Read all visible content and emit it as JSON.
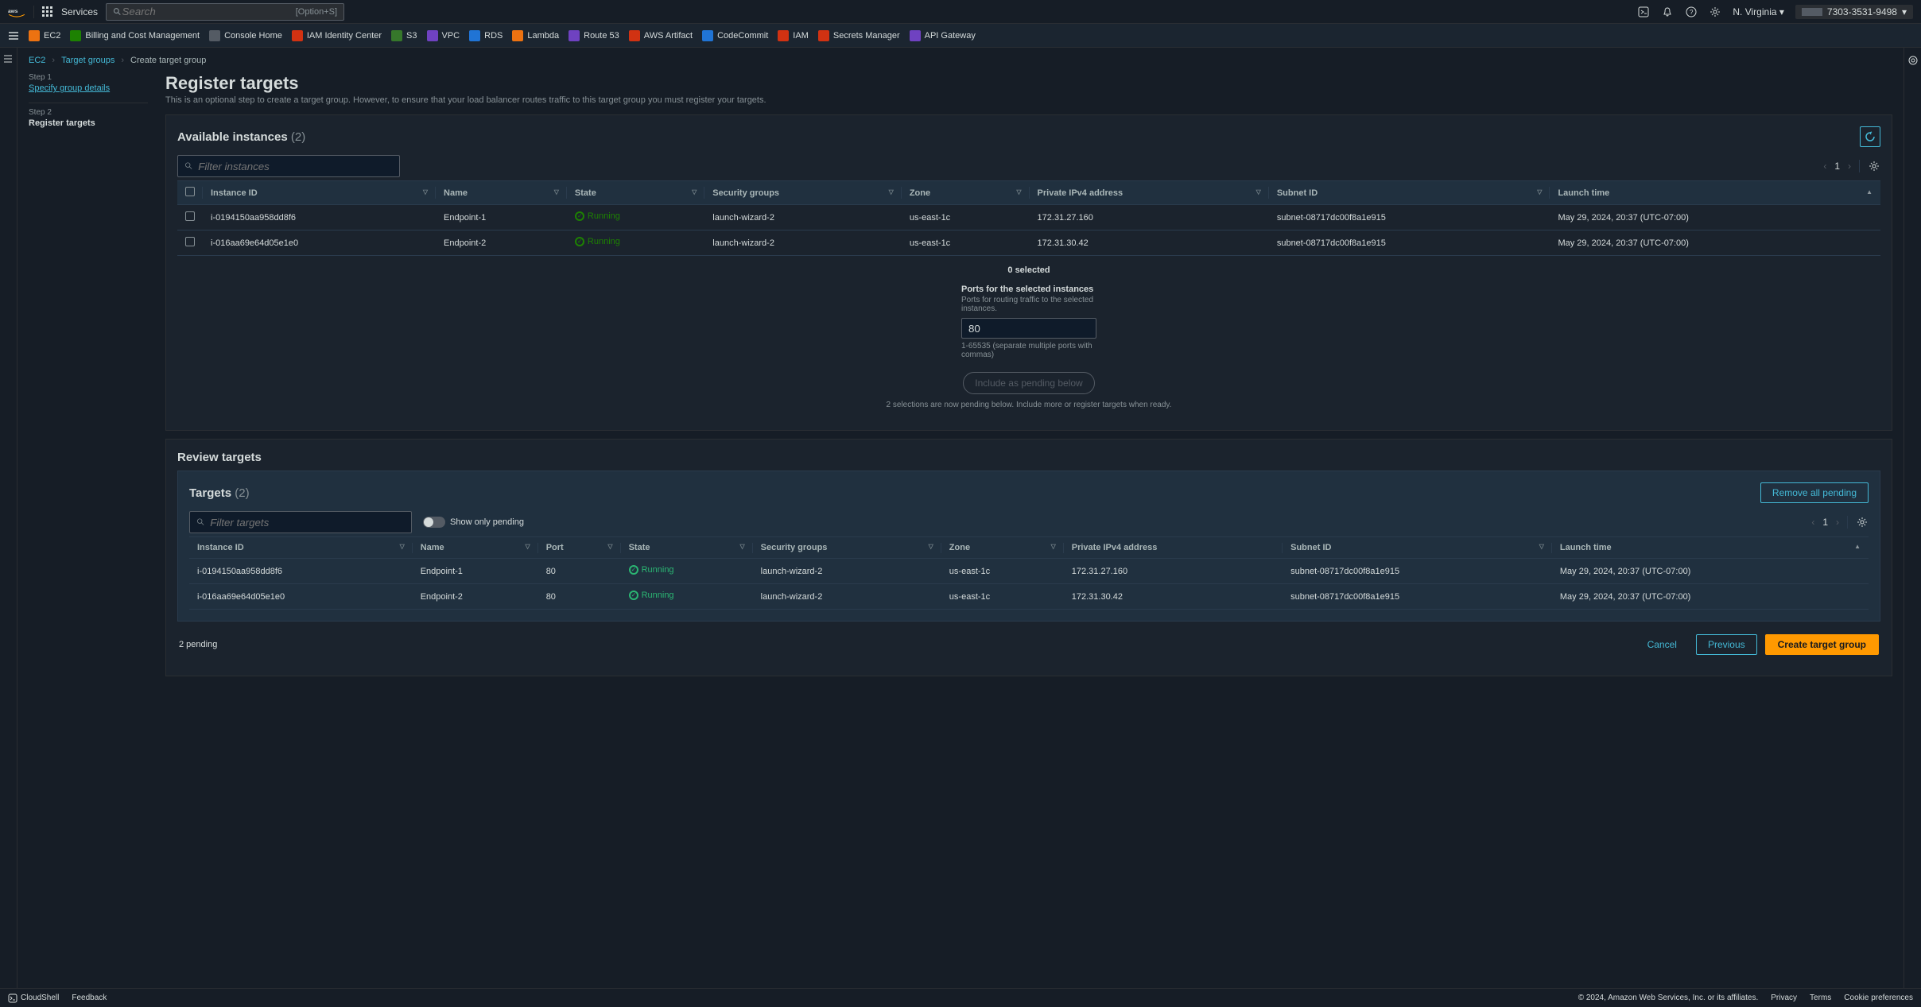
{
  "header": {
    "services_label": "Services",
    "search_placeholder": "Search",
    "search_hint": "[Option+S]",
    "region": "N. Virginia",
    "account_id": "7303-3531-9498"
  },
  "favorites": [
    {
      "label": "EC2",
      "color": "orange"
    },
    {
      "label": "Billing and Cost Management",
      "color": "green"
    },
    {
      "label": "Console Home",
      "color": "gray"
    },
    {
      "label": "IAM Identity Center",
      "color": "red"
    },
    {
      "label": "S3",
      "color": "dgreen"
    },
    {
      "label": "VPC",
      "color": "violet"
    },
    {
      "label": "RDS",
      "color": "blue"
    },
    {
      "label": "Lambda",
      "color": "orange"
    },
    {
      "label": "Route 53",
      "color": "violet"
    },
    {
      "label": "AWS Artifact",
      "color": "red"
    },
    {
      "label": "CodeCommit",
      "color": "blue"
    },
    {
      "label": "IAM",
      "color": "red"
    },
    {
      "label": "Secrets Manager",
      "color": "red"
    },
    {
      "label": "API Gateway",
      "color": "violet"
    }
  ],
  "breadcrumb": {
    "root": "EC2",
    "parent": "Target groups",
    "current": "Create target group"
  },
  "steps": {
    "step1_num": "Step 1",
    "step1_name": "Specify group details",
    "step2_num": "Step 2",
    "step2_name": "Register targets"
  },
  "page": {
    "title": "Register targets",
    "desc": "This is an optional step to create a target group. However, to ensure that your load balancer routes traffic to this target group you must register your targets."
  },
  "available": {
    "title": "Available instances",
    "count": "(2)",
    "filter_placeholder": "Filter instances",
    "page_num": "1",
    "columns": {
      "instance_id": "Instance ID",
      "name": "Name",
      "state": "State",
      "security_groups": "Security groups",
      "zone": "Zone",
      "private_ipv4": "Private IPv4 address",
      "subnet_id": "Subnet ID",
      "launch_time": "Launch time"
    },
    "rows": [
      {
        "instance_id": "i-0194150aa958dd8f6",
        "name": "Endpoint-1",
        "state": "Running",
        "sg": "launch-wizard-2",
        "zone": "us-east-1c",
        "ip": "172.31.27.160",
        "subnet": "subnet-08717dc00f8a1e915",
        "launch": "May 29, 2024, 20:37 (UTC-07:00)"
      },
      {
        "instance_id": "i-016aa69e64d05e1e0",
        "name": "Endpoint-2",
        "state": "Running",
        "sg": "launch-wizard-2",
        "zone": "us-east-1c",
        "ip": "172.31.30.42",
        "subnet": "subnet-08717dc00f8a1e915",
        "launch": "May 29, 2024, 20:37 (UTC-07:00)"
      }
    ],
    "selected_count": "0 selected",
    "ports_label": "Ports for the selected instances",
    "ports_help": "Ports for routing traffic to the selected instances.",
    "ports_value": "80",
    "ports_hint": "1-65535 (separate multiple ports with commas)",
    "include_btn": "Include as pending below",
    "pending_note": "2 selections are now pending below. Include more or register targets when ready."
  },
  "review": {
    "title": "Review targets",
    "targets_title": "Targets",
    "targets_count": "(2)",
    "remove_all_btn": "Remove all pending",
    "filter_placeholder": "Filter targets",
    "show_only_label": "Show only pending",
    "page_num": "1",
    "columns": {
      "instance_id": "Instance ID",
      "name": "Name",
      "port": "Port",
      "state": "State",
      "security_groups": "Security groups",
      "zone": "Zone",
      "private_ipv4": "Private IPv4 address",
      "subnet_id": "Subnet ID",
      "launch_time": "Launch time"
    },
    "rows": [
      {
        "instance_id": "i-0194150aa958dd8f6",
        "name": "Endpoint-1",
        "port": "80",
        "state": "Running",
        "sg": "launch-wizard-2",
        "zone": "us-east-1c",
        "ip": "172.31.27.160",
        "subnet": "subnet-08717dc00f8a1e915",
        "launch": "May 29, 2024, 20:37 (UTC-07:00)"
      },
      {
        "instance_id": "i-016aa69e64d05e1e0",
        "name": "Endpoint-2",
        "port": "80",
        "state": "Running",
        "sg": "launch-wizard-2",
        "zone": "us-east-1c",
        "ip": "172.31.30.42",
        "subnet": "subnet-08717dc00f8a1e915",
        "launch": "May 29, 2024, 20:37 (UTC-07:00)"
      }
    ]
  },
  "actions": {
    "pending_label": "2 pending",
    "cancel": "Cancel",
    "previous": "Previous",
    "create": "Create target group"
  },
  "footer": {
    "cloudshell": "CloudShell",
    "feedback": "Feedback",
    "copyright": "© 2024, Amazon Web Services, Inc. or its affiliates.",
    "privacy": "Privacy",
    "terms": "Terms",
    "cookie": "Cookie preferences"
  }
}
